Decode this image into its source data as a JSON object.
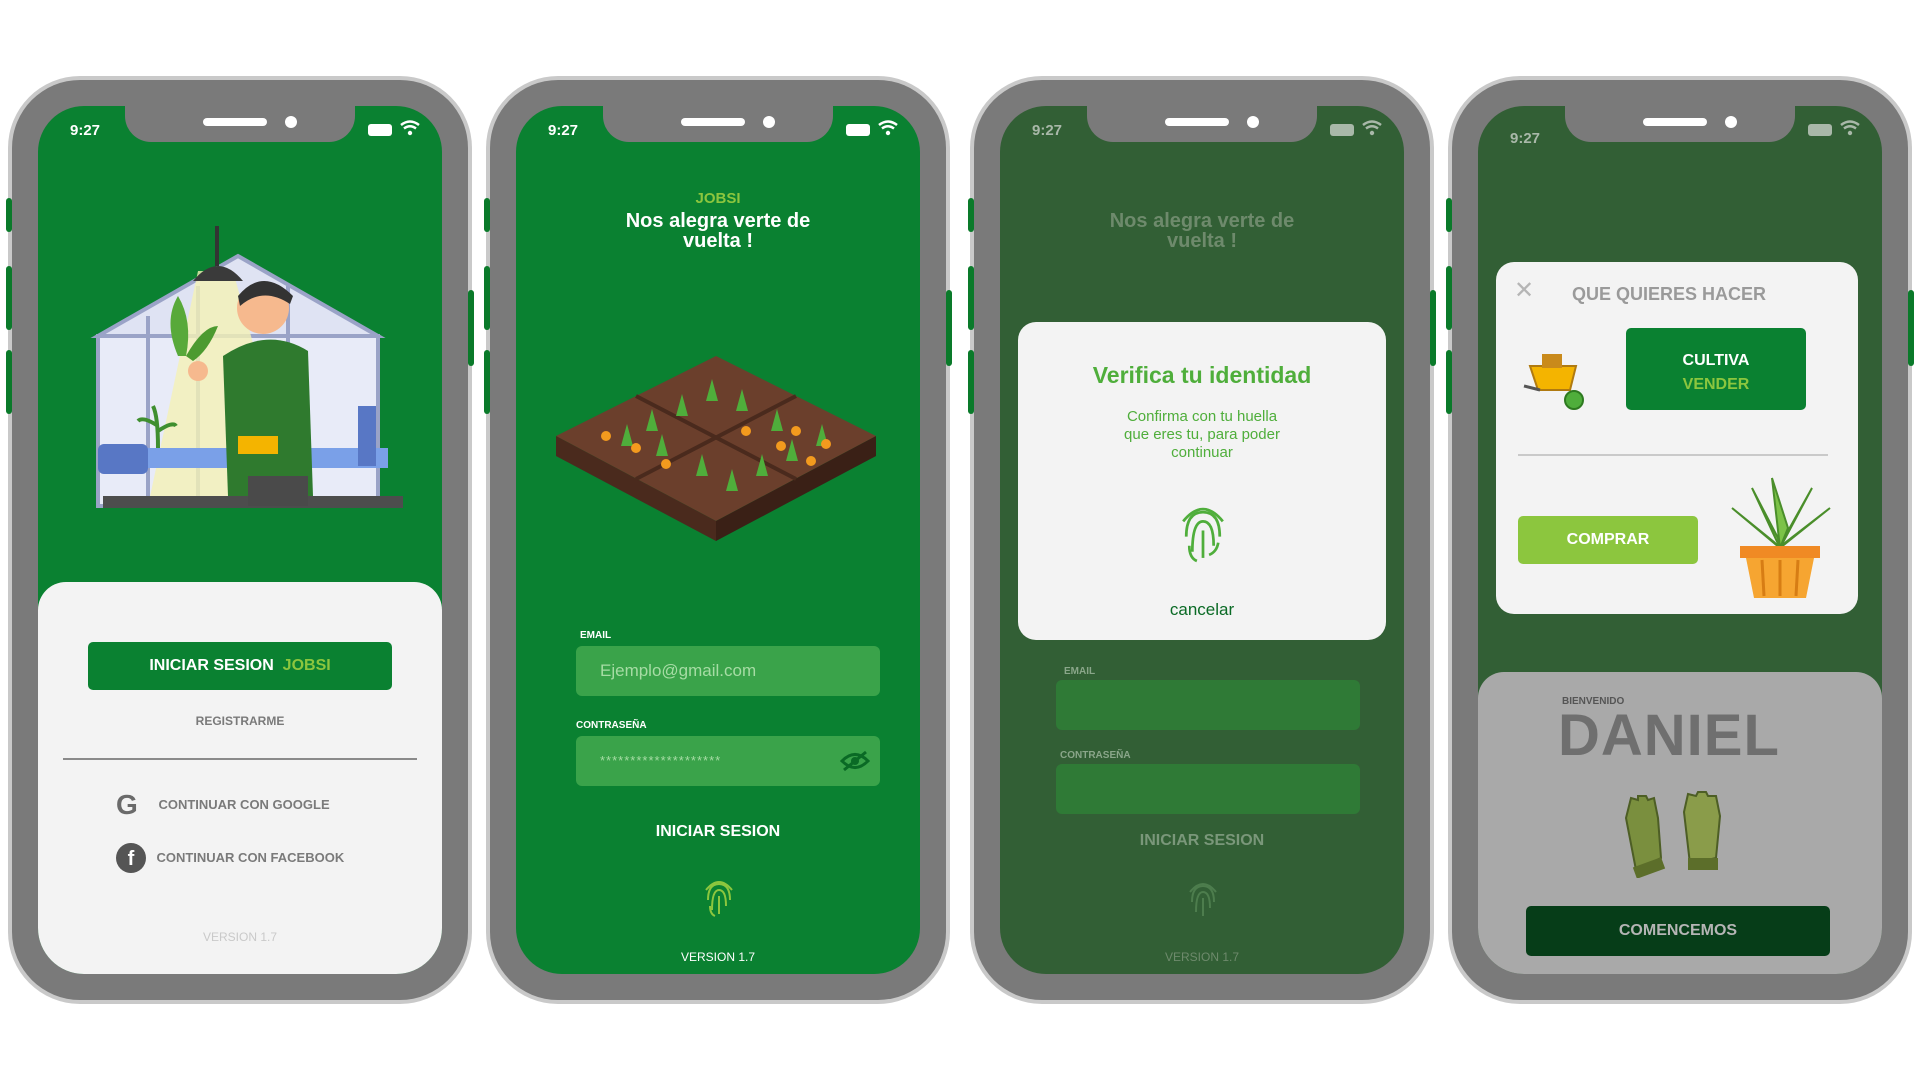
{
  "colors": {
    "green": "#0a8131",
    "light_green": "#8cc63e",
    "dark_green": "#074a1d",
    "card": "#f3f3f3",
    "gray": "#7a7a7a"
  },
  "status": {
    "time": "9:27"
  },
  "screen1": {
    "login_button": {
      "text": "INICIAR SESION",
      "brand": "JOBSI"
    },
    "register": "REGISTRARME",
    "google": "CONTINUAR CON GOOGLE",
    "facebook": "CONTINUAR CON FACEBOOK",
    "version": "VERSION 1.7"
  },
  "screen2": {
    "brand": "JOBSI",
    "title_line1": "Nos alegra verte de",
    "title_line2": "vuelta !",
    "email_label": "EMAIL",
    "email_placeholder": "Ejemplo@gmail.com",
    "password_label": "CONTRASEÑA",
    "password_value": "********************",
    "login": "INICIAR SESION",
    "version": "VERSION 1.7"
  },
  "screen3": {
    "title_line1": "Nos alegra verte de",
    "title_line2": "vuelta !",
    "dialog_title": "Verifica tu identidad",
    "dialog_line1": "Confirma con tu huella",
    "dialog_line2": "que eres tu, para poder",
    "dialog_line3": "continuar",
    "cancel": "cancelar",
    "email_label": "EMAIL",
    "password_label": "CONTRASEÑA",
    "login": "INICIAR SESION",
    "version": "VERSION 1.7"
  },
  "screen4": {
    "close": "✕",
    "dialog_title": "QUE QUIERES HACER",
    "cultiva": "CULTIVA",
    "vender": "VENDER",
    "comprar": "COMPRAR",
    "welcome": "BIENVENIDO",
    "name": "DANIEL",
    "start": "COMENCEMOS"
  }
}
